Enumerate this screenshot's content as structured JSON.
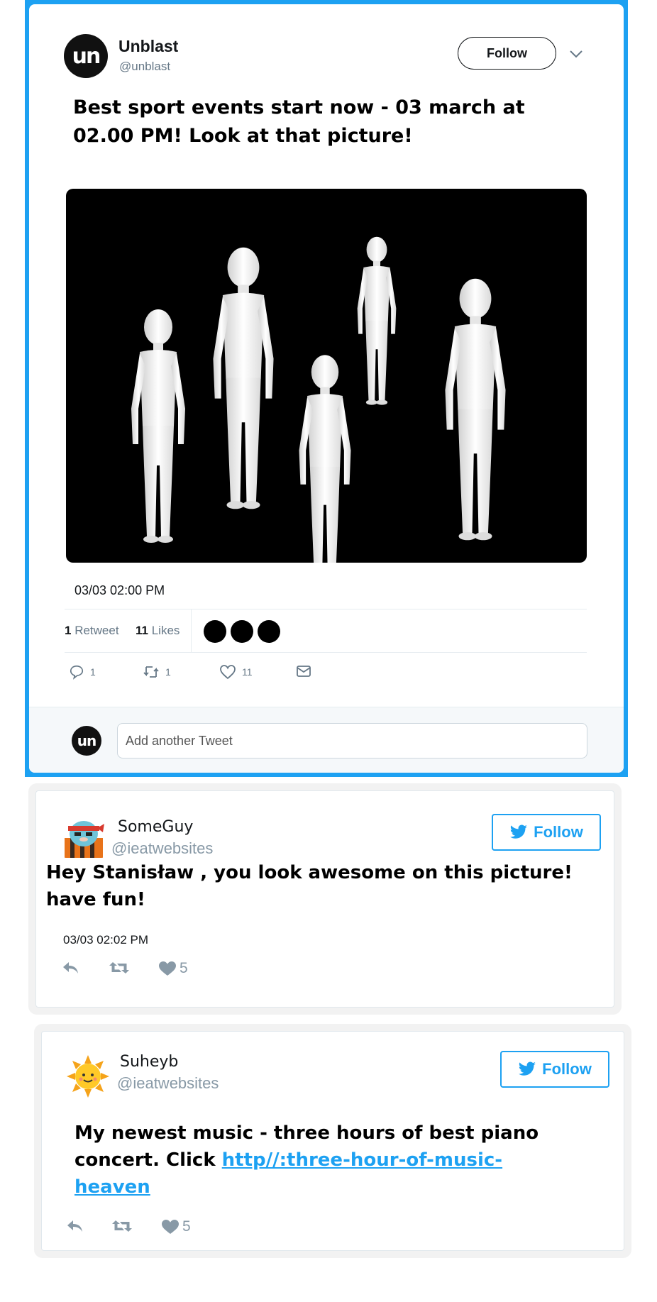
{
  "main_tweet": {
    "author": {
      "name": "Unblast",
      "handle": "@unblast",
      "avatar_text": "un"
    },
    "follow_label": "Follow",
    "text": "Best sport events start now - 03 march at 02.00 PM! Look at that picture!",
    "media": {
      "icon": "white-mannequin-figures-on-black"
    },
    "timestamp": "03/03 02:00 PM",
    "stats": {
      "retweets_count": "1",
      "retweets_label": "Retweet",
      "likes_count": "11",
      "likes_label": "Likes"
    },
    "actions": {
      "replies": "1",
      "retweets": "1",
      "likes": "11"
    },
    "reply_box": {
      "avatar_text": "un",
      "placeholder": "Add another Tweet"
    }
  },
  "replies": [
    {
      "name": "SomeGuy",
      "handle": "@ieatwebsites",
      "follow_label": "Follow",
      "text": "Hey Stanisław , you look awesome on this picture! have fun!",
      "timestamp": "03/03 02:02 PM",
      "likes": "5"
    },
    {
      "name": "Suheyb",
      "handle": "@ieatwebsites",
      "follow_label": "Follow",
      "text_prefix": "My newest music - three hours of best piano concert. Click ",
      "link_text": "http//:three-hour-of-music-heaven",
      "likes": "5"
    }
  ],
  "colors": {
    "accent": "#1da1f2",
    "text": "#14171a",
    "muted": "#657786"
  }
}
